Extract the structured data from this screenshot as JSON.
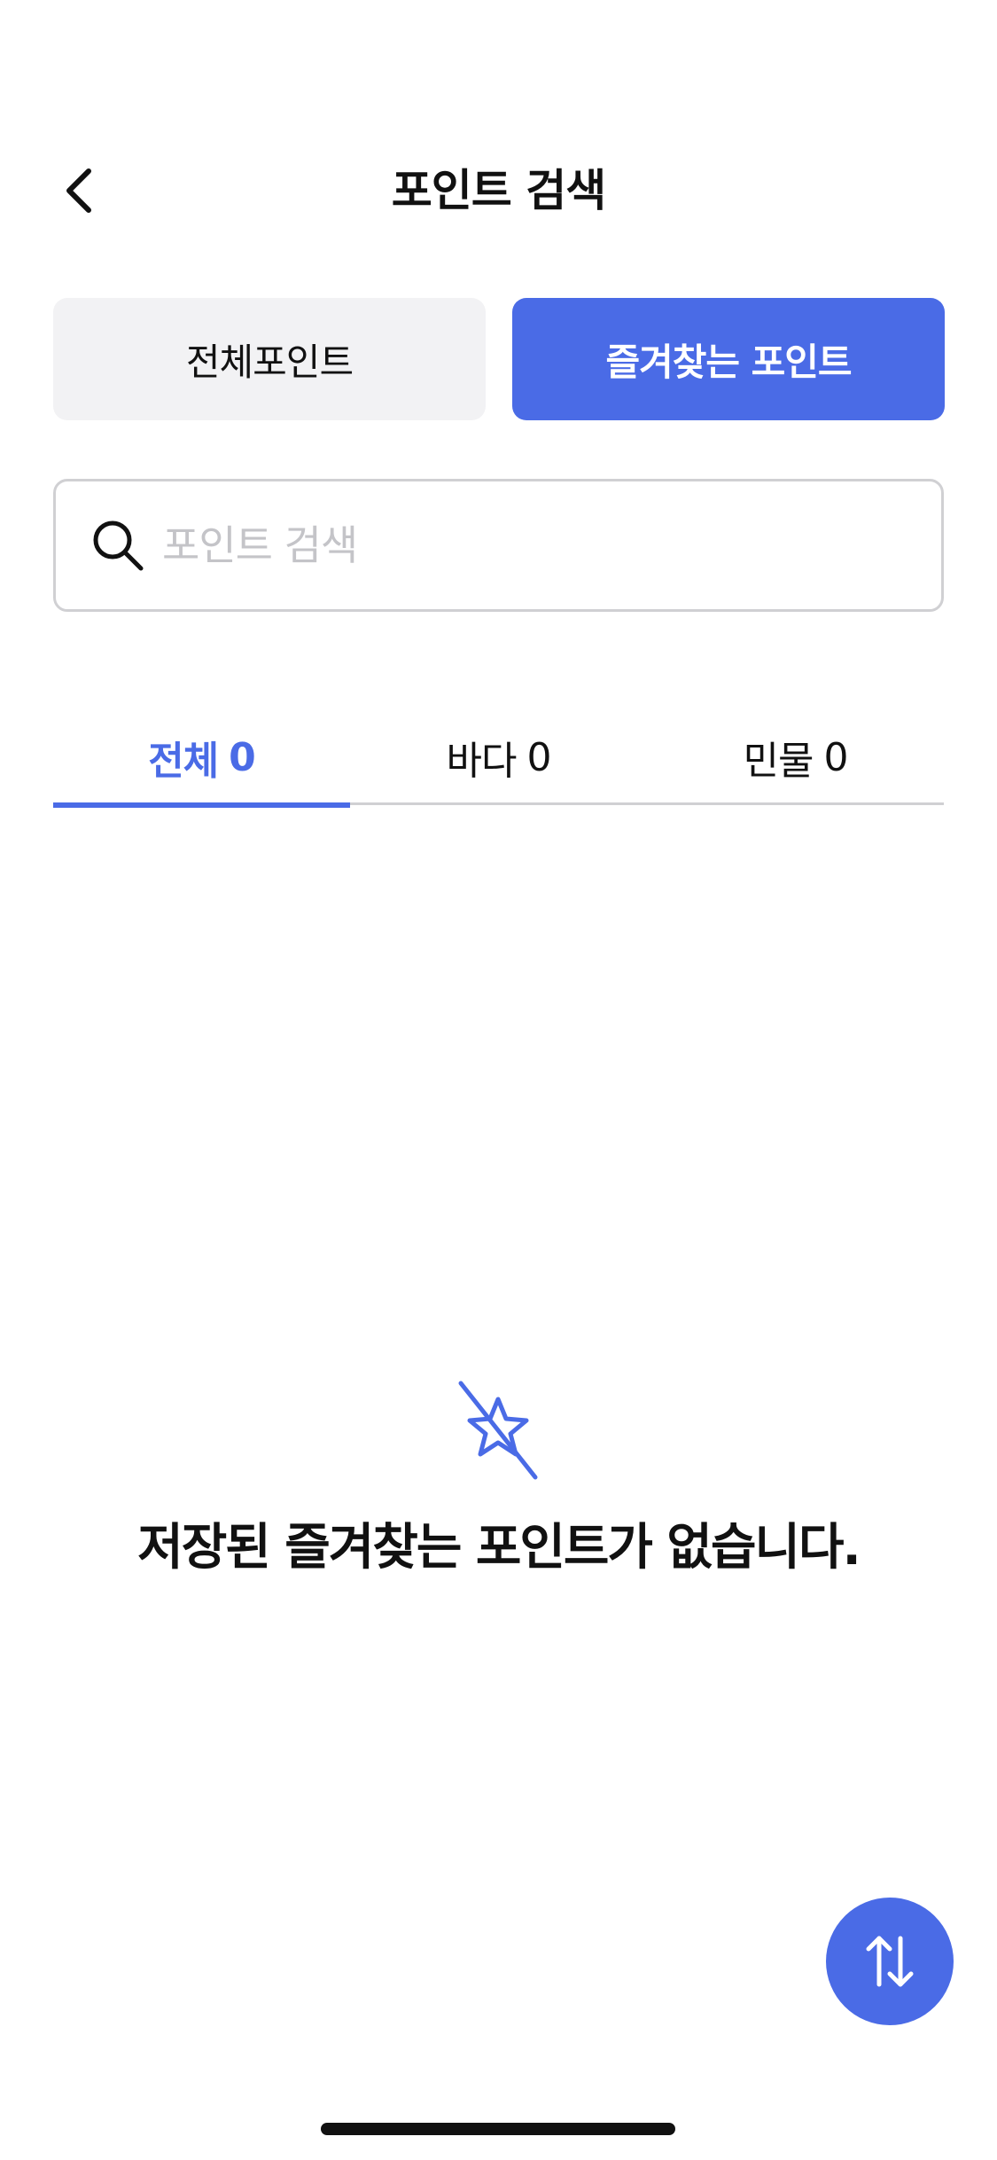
{
  "header": {
    "title": "포인트 검색",
    "back_icon": "chevron-left-icon"
  },
  "segments": {
    "all_label": "전체포인트",
    "favorites_label": "즐겨찾는 포인트",
    "selected": "favorites"
  },
  "search": {
    "placeholder": "포인트 검색",
    "value": "",
    "icon": "search-icon"
  },
  "tabs": [
    {
      "label": "전체",
      "count": "0",
      "active": true
    },
    {
      "label": "바다",
      "count": "0",
      "active": false
    },
    {
      "label": "민물",
      "count": "0",
      "active": false
    }
  ],
  "empty_state": {
    "icon": "star-off-icon",
    "message": "저장된 즐겨찾는 포인트가 없습니다."
  },
  "fab": {
    "icon": "sort-arrows-icon"
  },
  "colors": {
    "accent": "#4a6be6",
    "segment_inactive_bg": "#f2f2f4",
    "border": "#d0d0d3",
    "placeholder": "#c4c4c8",
    "text": "#111111"
  }
}
